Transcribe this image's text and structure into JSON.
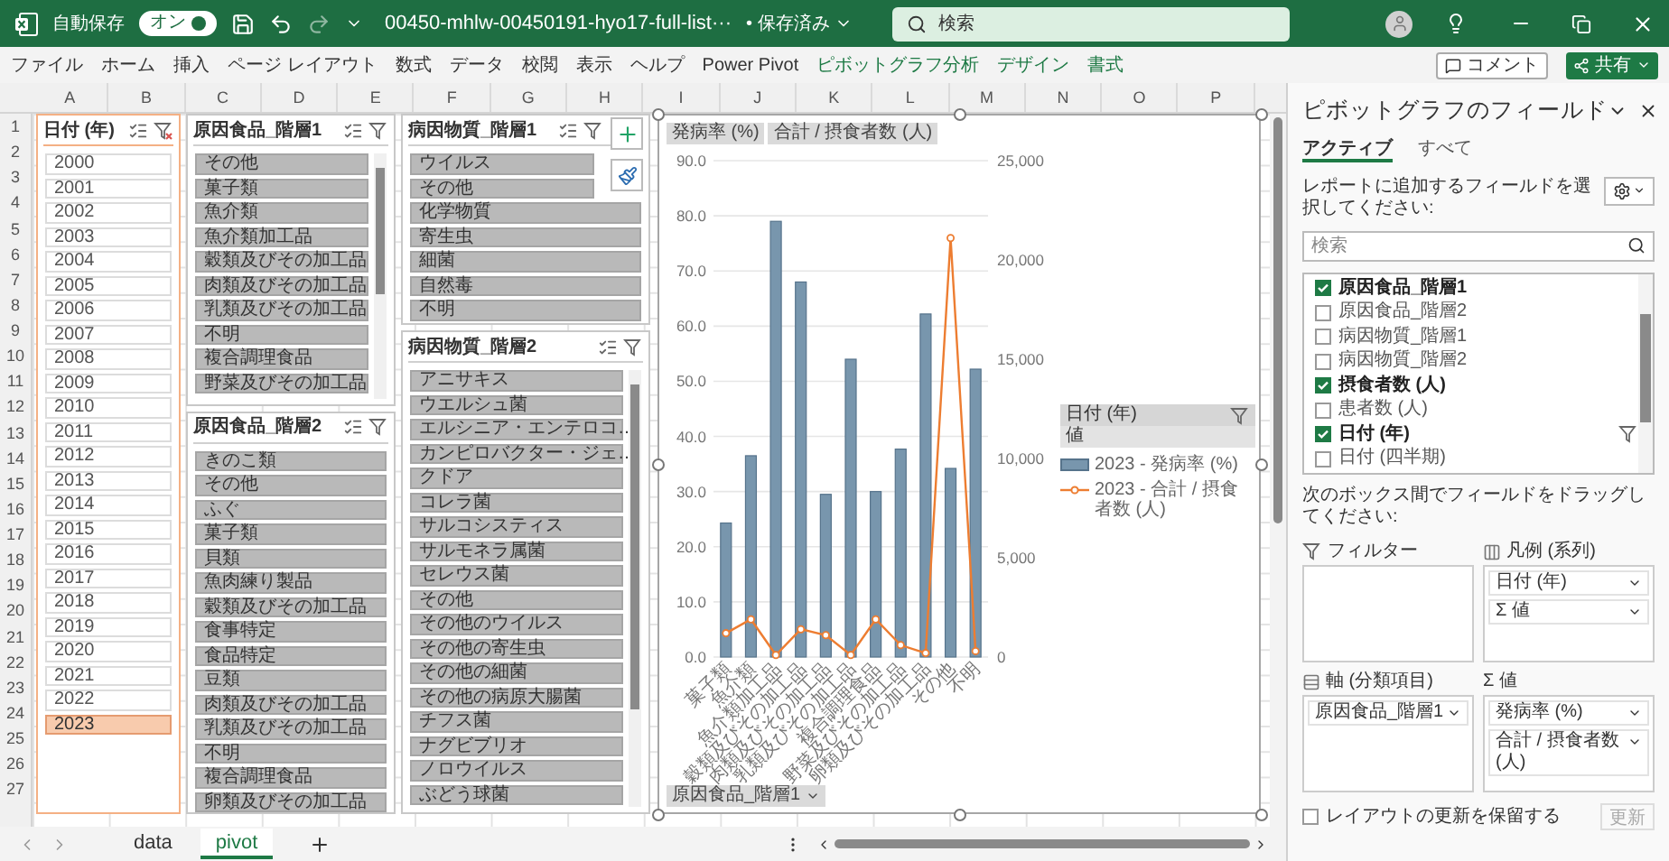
{
  "titlebar": {
    "autosave_label": "自動保存",
    "autosave": {
      "label": "オン",
      "on": true
    },
    "filename": "00450-mhlw-00450191-hyo17-full-list···",
    "save_status": "• 保存済み",
    "search": {
      "placeholder": "検索"
    }
  },
  "ribbon": {
    "tabs": [
      {
        "label": "ファイル",
        "contextual": false
      },
      {
        "label": "ホーム",
        "contextual": false
      },
      {
        "label": "挿入",
        "contextual": false
      },
      {
        "label": "ページ レイアウト",
        "contextual": false
      },
      {
        "label": "数式",
        "contextual": false
      },
      {
        "label": "データ",
        "contextual": false
      },
      {
        "label": "校閲",
        "contextual": false
      },
      {
        "label": "表示",
        "contextual": false
      },
      {
        "label": "ヘルプ",
        "contextual": false
      },
      {
        "label": "Power Pivot",
        "contextual": false
      },
      {
        "label": "ピボットグラフ分析",
        "contextual": true
      },
      {
        "label": "デザイン",
        "contextual": true
      },
      {
        "label": "書式",
        "contextual": true
      }
    ],
    "comment_button": "コメント",
    "share_button": "共有"
  },
  "columns": [
    "A",
    "B",
    "C",
    "D",
    "E",
    "F",
    "G",
    "H",
    "I",
    "J",
    "K",
    "L",
    "M",
    "N",
    "O",
    "P"
  ],
  "rows": [
    "1",
    "2",
    "3",
    "4",
    "5",
    "6",
    "7",
    "8",
    "9",
    "10",
    "11",
    "12",
    "13",
    "14",
    "15",
    "16",
    "17",
    "18",
    "19",
    "20",
    "21",
    "22",
    "23",
    "24",
    "25",
    "26",
    "27"
  ],
  "slicers": [
    {
      "title": "日付 (年)",
      "kind": "date",
      "filtered": true,
      "items": [
        {
          "label": "2000",
          "selected": false
        },
        {
          "label": "2001",
          "selected": false
        },
        {
          "label": "2002",
          "selected": false
        },
        {
          "label": "2003",
          "selected": false
        },
        {
          "label": "2004",
          "selected": false
        },
        {
          "label": "2005",
          "selected": false
        },
        {
          "label": "2006",
          "selected": false
        },
        {
          "label": "2007",
          "selected": false
        },
        {
          "label": "2008",
          "selected": false
        },
        {
          "label": "2009",
          "selected": false
        },
        {
          "label": "2010",
          "selected": false
        },
        {
          "label": "2011",
          "selected": false
        },
        {
          "label": "2012",
          "selected": false
        },
        {
          "label": "2013",
          "selected": false
        },
        {
          "label": "2014",
          "selected": false
        },
        {
          "label": "2015",
          "selected": false
        },
        {
          "label": "2016",
          "selected": false
        },
        {
          "label": "2017",
          "selected": false
        },
        {
          "label": "2018",
          "selected": false
        },
        {
          "label": "2019",
          "selected": false
        },
        {
          "label": "2020",
          "selected": false
        },
        {
          "label": "2021",
          "selected": false
        },
        {
          "label": "2022",
          "selected": false
        },
        {
          "label": "2023",
          "selected": true
        }
      ]
    },
    {
      "title": "原因食品_階層1",
      "kind": "text",
      "filtered": false,
      "items": [
        {
          "label": "その他",
          "selected": true
        },
        {
          "label": "菓子類",
          "selected": true
        },
        {
          "label": "魚介類",
          "selected": true
        },
        {
          "label": "魚介類加工品",
          "selected": true
        },
        {
          "label": "穀類及びその加工品",
          "selected": true
        },
        {
          "label": "肉類及びその加工品",
          "selected": true
        },
        {
          "label": "乳類及びその加工品",
          "selected": true
        },
        {
          "label": "不明",
          "selected": true
        },
        {
          "label": "複合調理食品",
          "selected": true
        },
        {
          "label": "野菜及びその加工品",
          "selected": true
        }
      ]
    },
    {
      "title": "原因食品_階層2",
      "kind": "text",
      "filtered": false,
      "items": [
        {
          "label": "きのこ類",
          "selected": true
        },
        {
          "label": "その他",
          "selected": true
        },
        {
          "label": "ふぐ",
          "selected": true
        },
        {
          "label": "菓子類",
          "selected": true
        },
        {
          "label": "貝類",
          "selected": true
        },
        {
          "label": "魚肉練り製品",
          "selected": true
        },
        {
          "label": "穀類及びその加工品",
          "selected": true
        },
        {
          "label": "食事特定",
          "selected": true
        },
        {
          "label": "食品特定",
          "selected": true
        },
        {
          "label": "豆類",
          "selected": true
        },
        {
          "label": "肉類及びその加工品",
          "selected": true
        },
        {
          "label": "乳類及びその加工品",
          "selected": true
        },
        {
          "label": "不明",
          "selected": true
        },
        {
          "label": "複合調理食品",
          "selected": true
        },
        {
          "label": "卵類及びその加工品",
          "selected": true
        }
      ]
    },
    {
      "title": "病因物質_階層1",
      "kind": "text",
      "filtered": false,
      "items": [
        {
          "label": "ウイルス",
          "selected": true
        },
        {
          "label": "その他",
          "selected": true
        },
        {
          "label": "化学物質",
          "selected": true
        },
        {
          "label": "寄生虫",
          "selected": true
        },
        {
          "label": "細菌",
          "selected": true
        },
        {
          "label": "自然毒",
          "selected": true
        },
        {
          "label": "不明",
          "selected": true
        }
      ]
    },
    {
      "title": "病因物質_階層2",
      "kind": "text",
      "filtered": false,
      "items": [
        {
          "label": "アニサキス",
          "selected": true
        },
        {
          "label": "ウエルシュ菌",
          "selected": true
        },
        {
          "label": "エルシニア・エンテロコ…",
          "selected": true
        },
        {
          "label": "カンピロバクター・ジェ…",
          "selected": true
        },
        {
          "label": "クドア",
          "selected": true
        },
        {
          "label": "コレラ菌",
          "selected": true
        },
        {
          "label": "サルコシスティス",
          "selected": true
        },
        {
          "label": "サルモネラ属菌",
          "selected": true
        },
        {
          "label": "セレウス菌",
          "selected": true
        },
        {
          "label": "その他",
          "selected": true
        },
        {
          "label": "その他のウイルス",
          "selected": true
        },
        {
          "label": "その他の寄生虫",
          "selected": true
        },
        {
          "label": "その他の細菌",
          "selected": true
        },
        {
          "label": "その他の病原大腸菌",
          "selected": true
        },
        {
          "label": "チフス菌",
          "selected": true
        },
        {
          "label": "ナグビブリオ",
          "selected": true
        },
        {
          "label": "ノロウイルス",
          "selected": true
        },
        {
          "label": "ぶどう球菌",
          "selected": true
        }
      ]
    }
  ],
  "chart": {
    "value_fields": [
      "発病率 (%)",
      "合計 / 摂食者数 (人)"
    ],
    "axis_field": "原因食品_階層1",
    "legend": {
      "field": "日付 (年)",
      "values_label": "値"
    },
    "chart_data": {
      "type": "bar",
      "categories": [
        "菓子類",
        "魚介類",
        "魚介類加工品",
        "穀類及びその加工品",
        "肉類及びその加工品",
        "乳類及びその加工品",
        "複合調理食品",
        "野菜及びその加工品",
        "卵類及びその加工品",
        "その他",
        "不明"
      ],
      "series": [
        {
          "name": "2023 - 発病率 (%)",
          "color": "#7896ad",
          "values": [
            24.3,
            36.5,
            79.0,
            68.0,
            29.5,
            54.0,
            30.0,
            37.7,
            62.2,
            34.2,
            52.2
          ]
        },
        {
          "name": "2023 - 合計 / 摂食者数 (人)",
          "color": "#ed7d31",
          "type": "line",
          "axis": "y2",
          "marker": true,
          "values": [
            1200,
            1900,
            100,
            1400,
            1100,
            100,
            1900,
            600,
            200,
            21100,
            300
          ]
        }
      ],
      "grid": true,
      "legend": "right",
      "ylim": [
        0,
        90
      ],
      "yticks": [
        {
          "value": 0,
          "label": "0.0"
        },
        {
          "value": 10,
          "label": "10.0"
        },
        {
          "value": 20,
          "label": "20.0"
        },
        {
          "value": 30,
          "label": "30.0"
        },
        {
          "value": 40,
          "label": "40.0"
        },
        {
          "value": 50,
          "label": "50.0"
        },
        {
          "value": 60,
          "label": "60.0"
        },
        {
          "value": 70,
          "label": "70.0"
        },
        {
          "value": 80,
          "label": "80.0"
        },
        {
          "value": 90,
          "label": "90.0"
        }
      ],
      "y2lim": [
        0,
        25000
      ],
      "y2ticks": [
        {
          "value": 0,
          "label": "0"
        },
        {
          "value": 5000,
          "label": "5,000"
        },
        {
          "value": 10000,
          "label": "10,000"
        },
        {
          "value": 15000,
          "label": "15,000"
        },
        {
          "value": 20000,
          "label": "20,000"
        },
        {
          "value": 25000,
          "label": "25,000"
        }
      ]
    }
  },
  "pane": {
    "title": "ピボットグラフのフィールド",
    "tabs": [
      {
        "label": "アクティブ",
        "selected": true
      },
      {
        "label": "すべて",
        "selected": false
      }
    ],
    "instruction": "レポートに追加するフィールドを選択してください:",
    "search": {
      "placeholder": "検索"
    },
    "fields": [
      {
        "label": "原因食品_階層1",
        "checked": true,
        "filtered": false
      },
      {
        "label": "原因食品_階層2",
        "checked": false,
        "filtered": false
      },
      {
        "label": "病因物質_階層1",
        "checked": false,
        "filtered": false
      },
      {
        "label": "病因物質_階層2",
        "checked": false,
        "filtered": false
      },
      {
        "label": "摂食者数 (人)",
        "checked": true,
        "filtered": false
      },
      {
        "label": "患者数 (人)",
        "checked": false,
        "filtered": false
      },
      {
        "label": "日付 (年)",
        "checked": true,
        "filtered": true
      },
      {
        "label": "日付 (四半期)",
        "checked": false,
        "filtered": false
      }
    ],
    "drag_instruction": "次のボックス間でフィールドをドラッグしてください:",
    "areas": [
      {
        "kind": "filter",
        "title": "フィルター"
      },
      {
        "kind": "legend",
        "title": "凡例 (系列)",
        "items": [
          "日付 (年)",
          "Σ 値"
        ]
      },
      {
        "kind": "axis",
        "title": "軸 (分類項目)",
        "items": [
          "原因食品_階層1"
        ]
      },
      {
        "kind": "values",
        "title": "Σ 値",
        "items": [
          "発病率 (%)",
          "合計 / 摂食者数 (人)"
        ]
      }
    ],
    "defer": {
      "label": "レイアウトの更新を保留する",
      "checked": false
    },
    "update_button": {
      "label": "更新",
      "disabled": true
    }
  },
  "sheet_tabs": [
    {
      "label": "data",
      "selected": false
    },
    {
      "label": "pivot",
      "selected": true
    }
  ]
}
